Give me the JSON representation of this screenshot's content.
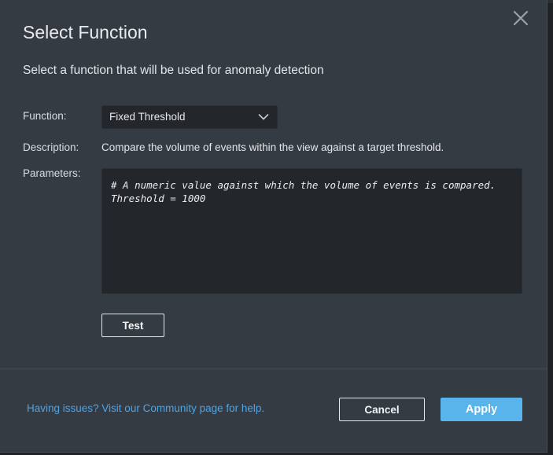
{
  "dialog": {
    "title": "Select Function",
    "subtitle": "Select a function that will be used for anomaly detection",
    "close_icon": "close-icon"
  },
  "form": {
    "function_label": "Function:",
    "function_value": "Fixed Threshold",
    "description_label": "Description:",
    "description_text": "Compare the volume of events within the view against a target threshold.",
    "parameters_label": "Parameters:",
    "parameters_value": "# A numeric value against which the volume of events is compared.\nThreshold = 1000",
    "test_label": "Test"
  },
  "footer": {
    "help_text": "Having issues? Visit our Community page for help.",
    "cancel_label": "Cancel",
    "apply_label": "Apply"
  },
  "colors": {
    "dialog_bg": "#353b43",
    "field_bg": "#23272c",
    "accent": "#5ab4ec",
    "link": "#4aa5e8"
  }
}
